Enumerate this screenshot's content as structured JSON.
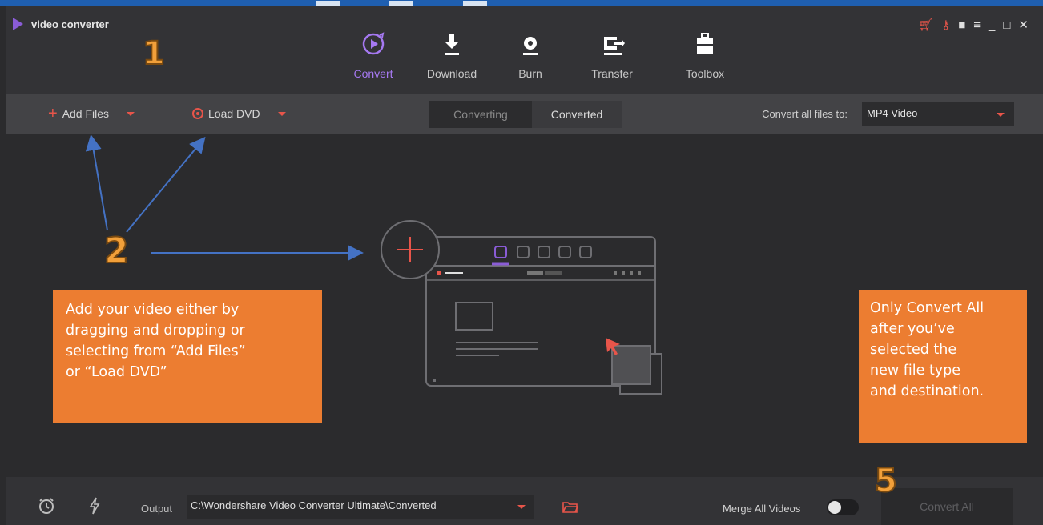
{
  "app": {
    "title": "video converter"
  },
  "annotations": {
    "step1": "1",
    "step2": "2",
    "step5": "5",
    "left_box_lines": [
      "Add your video either by",
      "dragging and dropping or",
      "selecting from “Add Files”",
      "or “Load DVD”"
    ],
    "right_box_lines": [
      "Only Convert All",
      "after you’ve",
      "selected the",
      "new file type",
      "and destination."
    ]
  },
  "nav": {
    "tabs": [
      {
        "label": "Convert",
        "icon": "convert-icon",
        "active": true
      },
      {
        "label": "Download",
        "icon": "download-icon",
        "active": false
      },
      {
        "label": "Burn",
        "icon": "burn-icon",
        "active": false
      },
      {
        "label": "Transfer",
        "icon": "transfer-icon",
        "active": false
      },
      {
        "label": "Toolbox",
        "icon": "toolbox-icon",
        "active": false
      }
    ]
  },
  "toolbar": {
    "add_files": "Add Files",
    "load_dvd": "Load DVD",
    "seg_converting": "Converting",
    "seg_converted": "Converted",
    "convert_all_label": "Convert all files to:",
    "format_value": "MP4 Video"
  },
  "footer": {
    "output_label": "Output",
    "output_path": "C:\\Wondershare Video Converter Ultimate\\Converted",
    "merge_label": "Merge All Videos",
    "merge_on": false,
    "convert_all": "Convert All"
  },
  "colors": {
    "accent_purple": "#8a5cd6",
    "accent_red": "#e8554a",
    "annotation_orange": "#ec7d31",
    "arrow_blue": "#4472c4"
  }
}
